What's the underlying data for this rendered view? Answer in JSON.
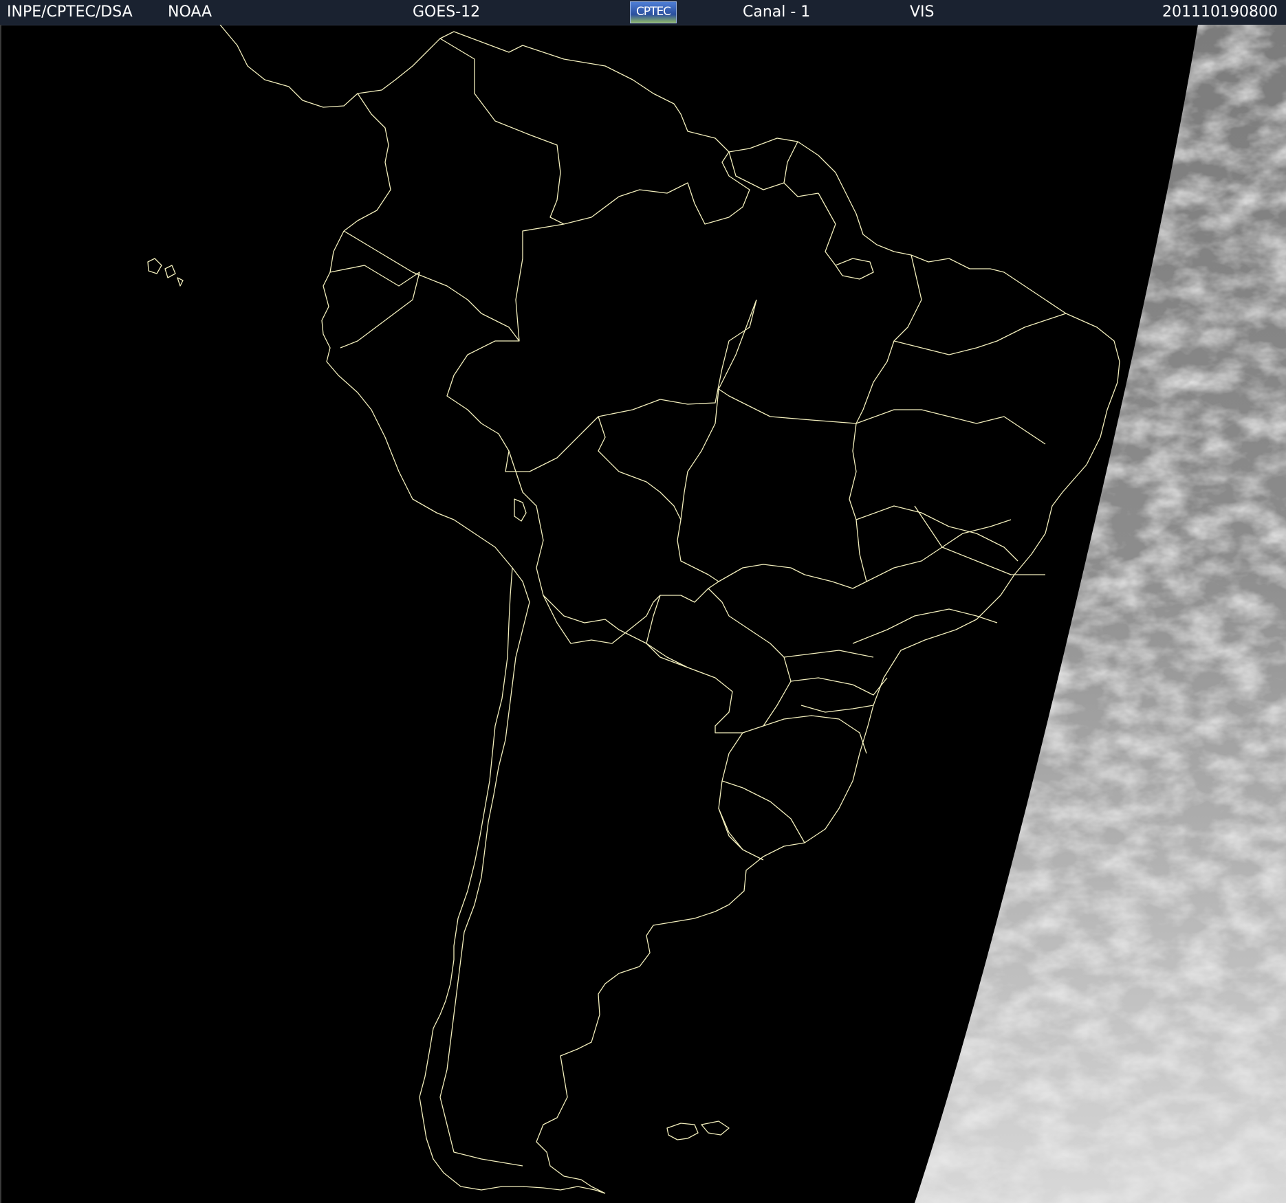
{
  "header": {
    "source": "INPE/CPTEC/DSA",
    "agency": "NOAA",
    "satellite": "GOES-12",
    "logo_text": "CPTEC",
    "channel": "Canal - 1",
    "band": "VIS",
    "timestamp": "201110190800"
  },
  "colors": {
    "header_bg": "#1a2230",
    "background": "#000000",
    "coastline": "#f2eebc",
    "cloud": "#d8d8d8",
    "earth_disk": "#8a8a8a"
  },
  "icons": {
    "logo": "cptec-logo"
  }
}
